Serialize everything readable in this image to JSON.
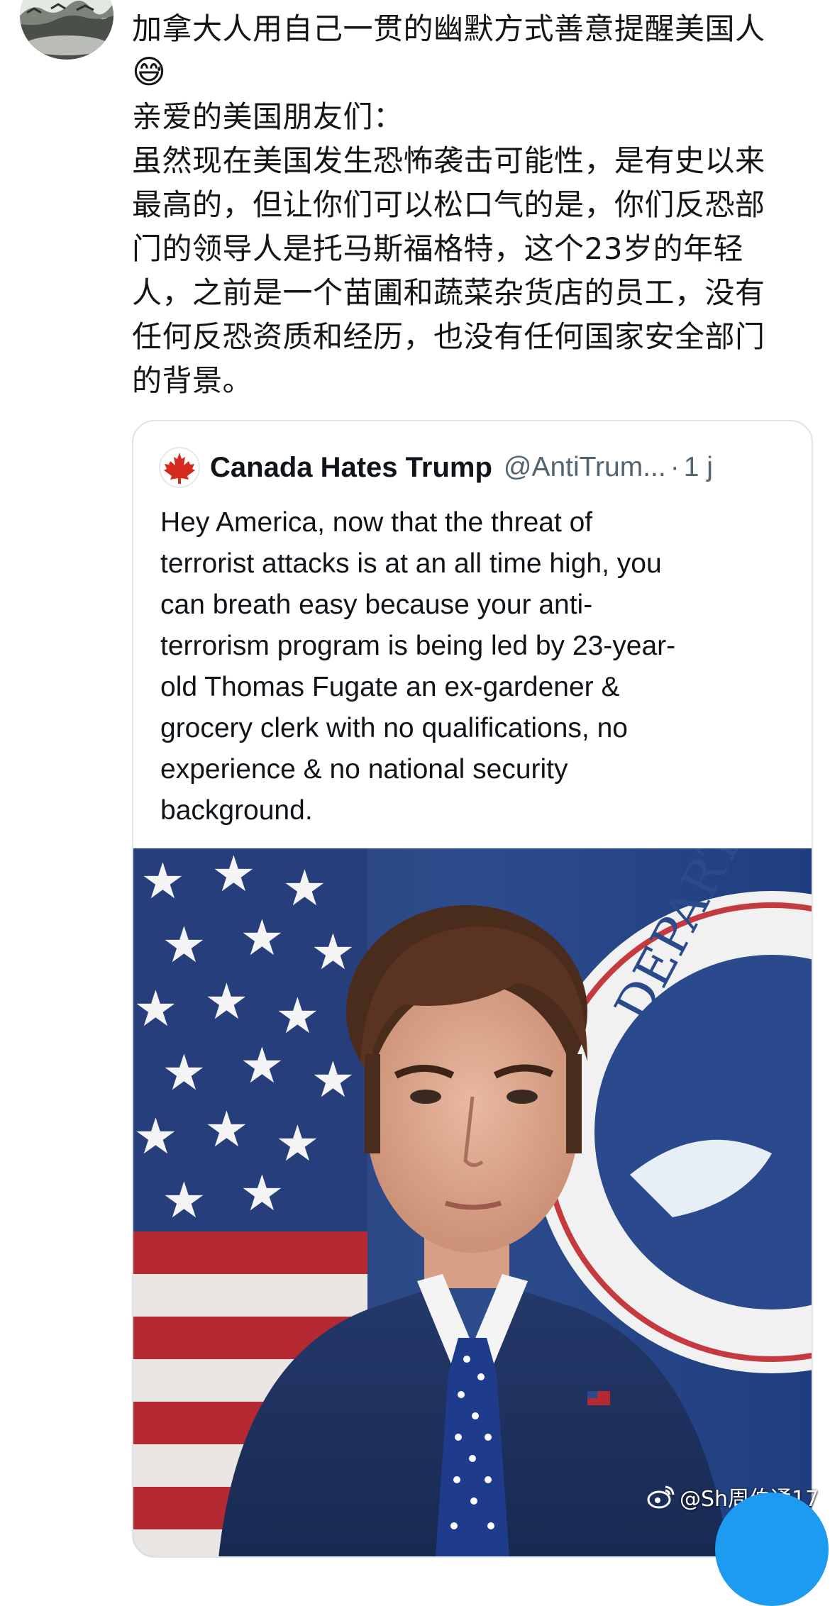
{
  "post": {
    "lines": [
      "加拿大人用自己一贯的幽默方式善意提醒美国人",
      "亲爱的美国朋友们：",
      "虽然现在美国发生恐怖袭击可能性，是有史以来",
      "最高的，但让你们可以松口气的是，你们反恐部",
      "门的领导人是托马斯福格特，这个23岁的年轻",
      "人，之前是一个苗圃和蔬菜杂货店的员工，没有",
      "任何反恐资质和经历，也没有任何国家安全部门",
      "的背景。"
    ],
    "emoji": "😅"
  },
  "quote": {
    "name": "Canada Hates Trump",
    "handle": "@AntiTrum...",
    "dot": "·",
    "time": "1 j",
    "lines": [
      "Hey America, now that the threat of",
      "terrorist attacks is at an all time high, you",
      "can breath easy because your anti-",
      "terrorism program is being led by 23-year-",
      "old Thomas Fugate an ex-gardener &",
      "grocery clerk with no qualifications, no",
      "experience & no national security",
      "background."
    ],
    "photo_seal_text": "DEPARTME"
  },
  "watermark": {
    "text": "@Sh周伯通17"
  },
  "colors": {
    "accent_blue": "#1d9bf0",
    "canada_red": "#d52b1e",
    "suit_navy": "#1e2f57",
    "secondary_text": "#536471"
  },
  "icons": {
    "avatar": "landscape-avatar",
    "quote_avatar": "maple-leaf-icon",
    "watermark": "weibo-icon"
  }
}
